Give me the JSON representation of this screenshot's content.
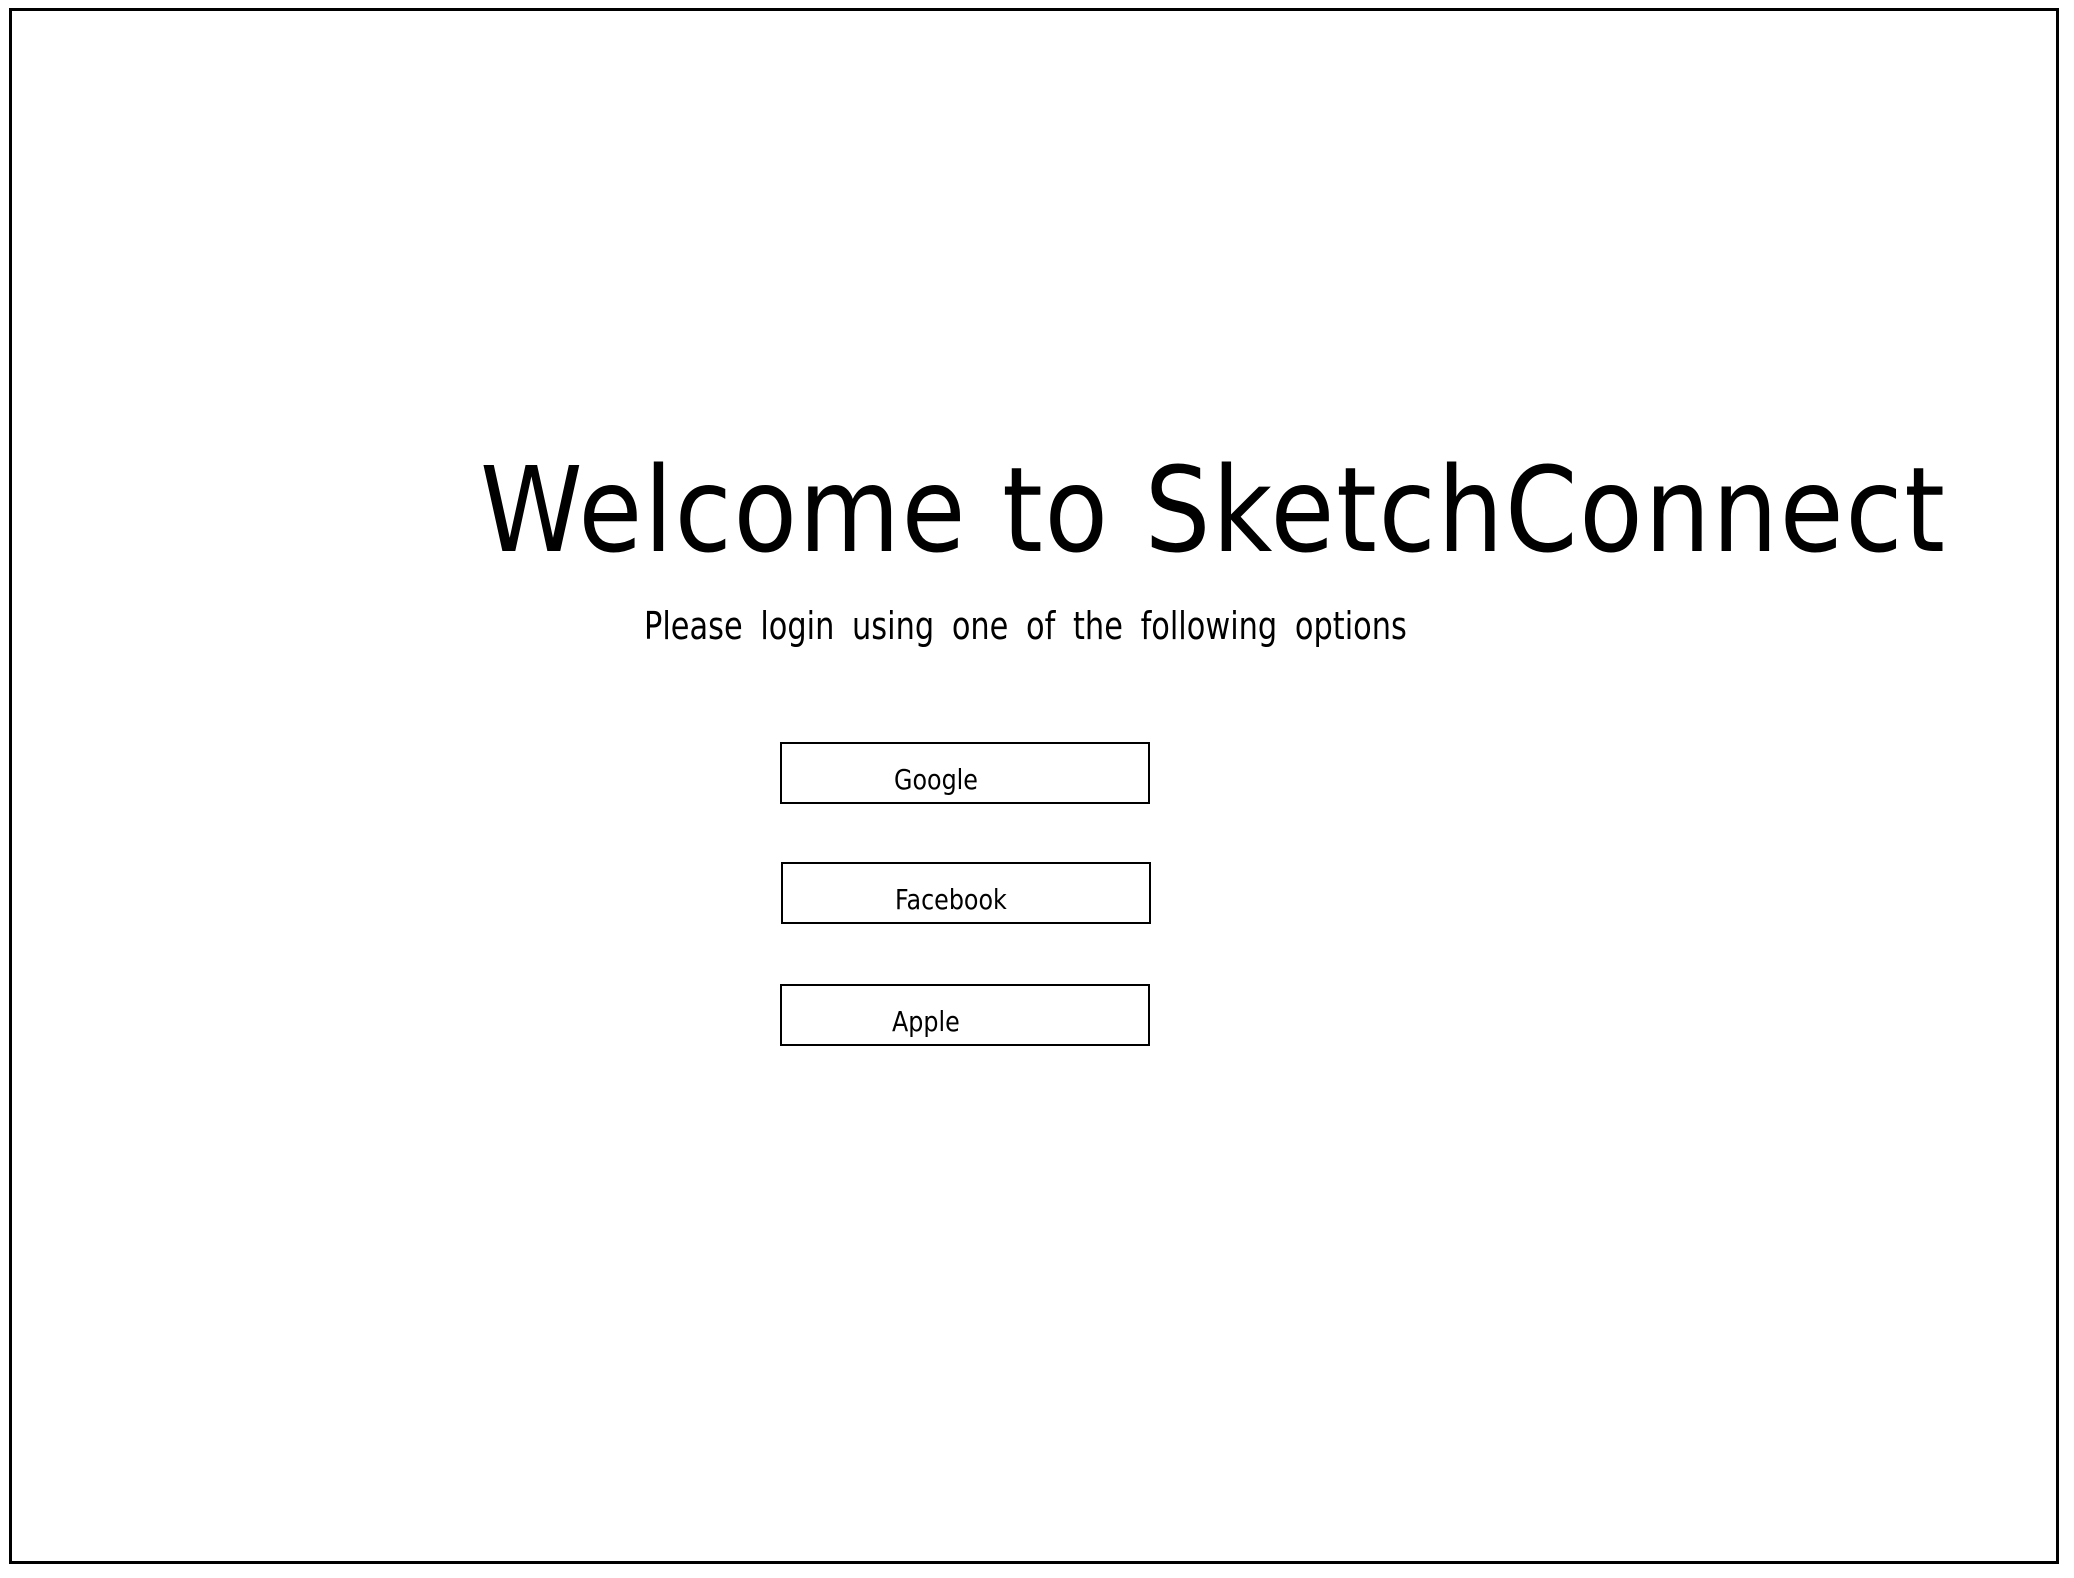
{
  "header": {
    "title": "Welcome to SketchConnect",
    "subtitle": "Please login using one of the following options"
  },
  "login_options": [
    {
      "label": "Google"
    },
    {
      "label": "Facebook"
    },
    {
      "label": "Apple"
    }
  ]
}
